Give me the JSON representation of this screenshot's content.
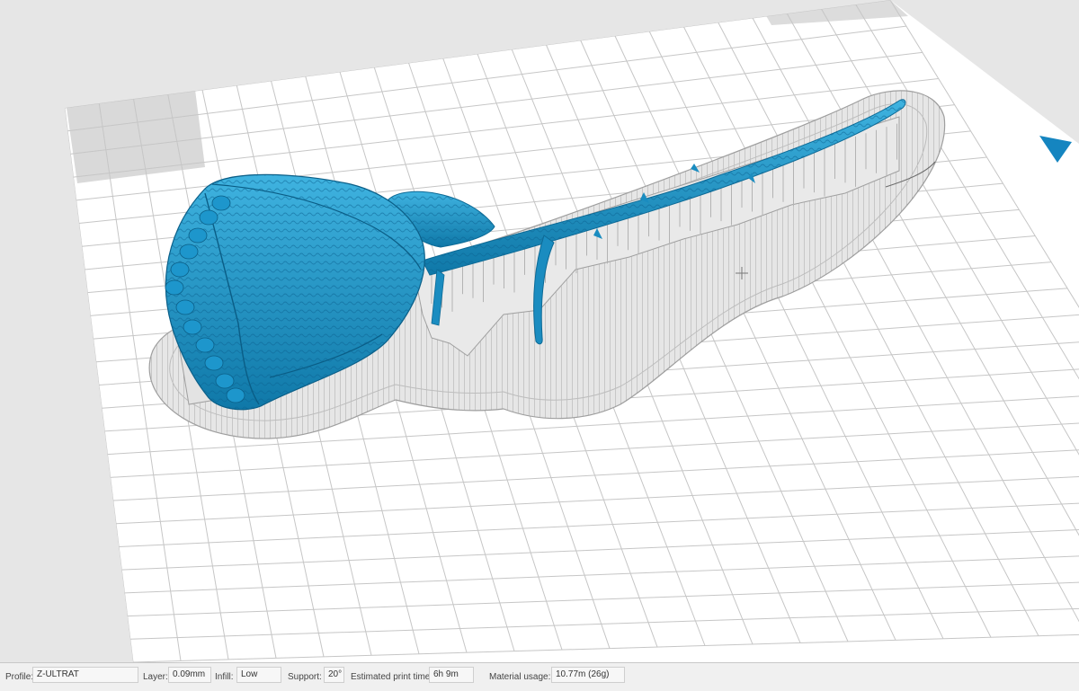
{
  "viewport": {
    "model_color": "#1b91c4",
    "support_color": "#cfcfcf",
    "grid_color": "#c6c6c6",
    "plate_color": "#ffffff",
    "camera_arrow_color": "#1585c0",
    "camera_arrow_icon": "triangle-icon",
    "cursor_icon": "crosshair-icon"
  },
  "status": {
    "profile_label": "Profile:",
    "profile_value": "Z-ULTRAT",
    "layer_label": "Layer:",
    "layer_value": "0.09mm",
    "infill_label": "Infill:",
    "infill_value": "Low",
    "support_label": "Support:",
    "support_value": "20°",
    "print_time_label": "Estimated print time:",
    "print_time_value": "6h 9m",
    "material_label": "Material usage:",
    "material_value": "10.77m (26g)"
  }
}
